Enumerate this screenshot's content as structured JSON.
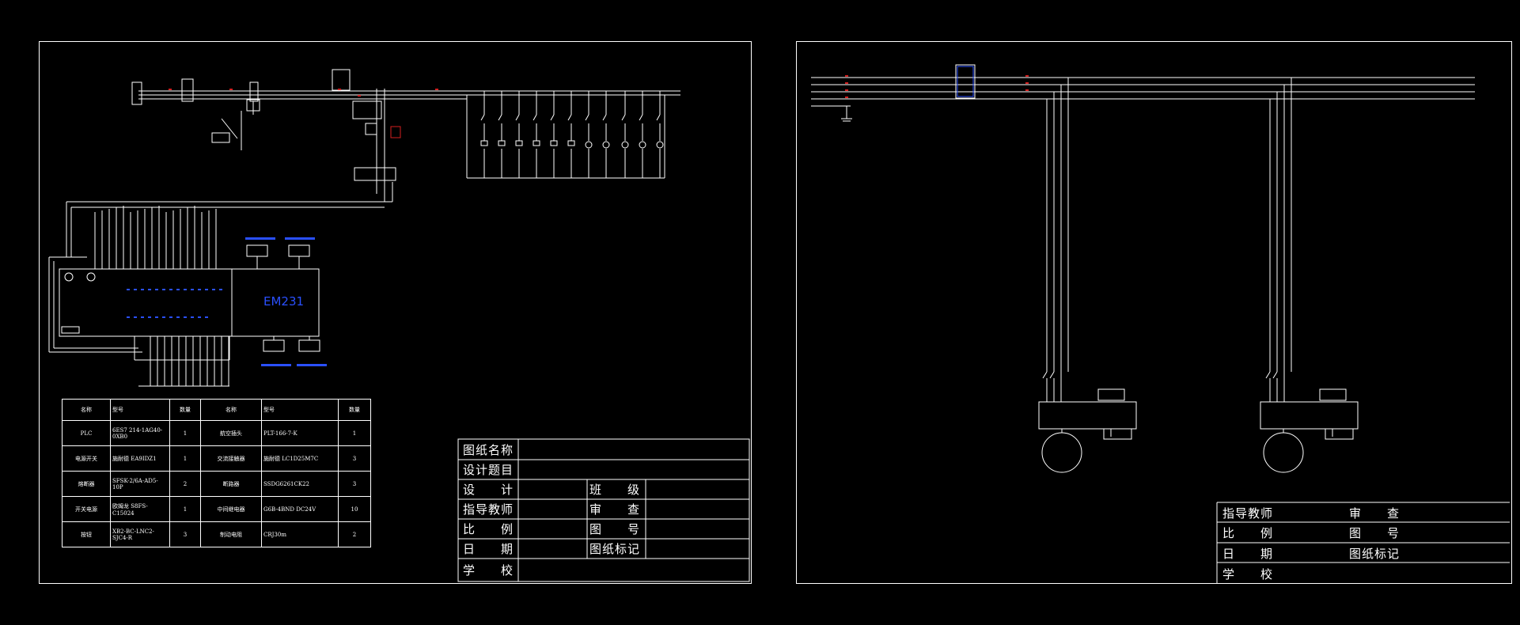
{
  "colors": {
    "background": "#000000",
    "line": "#ffffff",
    "blue": "#2a50ff",
    "red": "#d42020",
    "green": "#20c040"
  },
  "left_sheet": {
    "module_label": "EM231",
    "bom_table": {
      "headers": [
        "名称",
        "型号",
        "数量",
        "名称",
        "型号",
        "数量"
      ],
      "rows": [
        [
          "PLC",
          "6ES7 214-1AG40-0XB0",
          "1",
          "航空插头",
          "PLT-166-7-K",
          "1"
        ],
        [
          "电源开关",
          "施耐德 EA9IDZ1",
          "1",
          "交流接触器",
          "施耐德 LC1D25M7C",
          "3"
        ],
        [
          "熔断器",
          "SFSK-2/6A-AD5-10P",
          "2",
          "断路器",
          "SSDG6261CK22",
          "3"
        ],
        [
          "开关电源",
          "欧姆龙 S8FS-C15024",
          "1",
          "中间继电器",
          "G6B-4BND DC24V",
          "10"
        ],
        [
          "按钮",
          "XB2-BC-LNC2-SJC4-R",
          "3",
          "制动电阻",
          "CRJ30m",
          "2"
        ]
      ]
    },
    "title_block": {
      "drawing_name_label": "图纸名称",
      "design_topic_label": "设计题目",
      "design_label": "设　　计",
      "class_label": "班　　级",
      "advisor_label": "指导教师",
      "review_label": "审　　查",
      "scale_label": "比　　例",
      "drawing_no_label": "图　　号",
      "date_label": "日　　期",
      "drawing_mark_label": "图纸标记",
      "school_label": "学　　校"
    }
  },
  "right_sheet": {
    "title_block": {
      "advisor_label": "指导教师",
      "review_label": "审　　查",
      "scale_label": "比　　例",
      "drawing_no_label": "图　　号",
      "date_label": "日　　期",
      "drawing_mark_label": "图纸标记",
      "school_label": "学　　校"
    }
  }
}
